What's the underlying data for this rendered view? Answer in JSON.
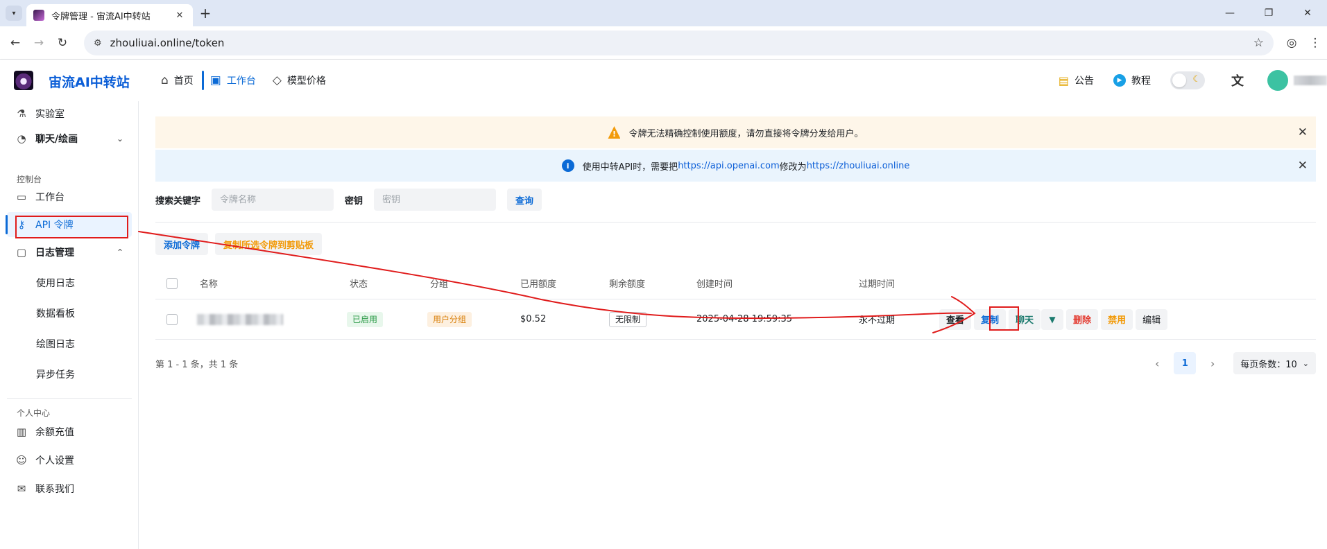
{
  "browser": {
    "tab_title": "令牌管理 - 宙流AI中转站",
    "url": "zhouliuai.online/token",
    "new_tab": "+",
    "min": "—",
    "restore": "❐",
    "close": "✕"
  },
  "header": {
    "brand": "宙流AI中转站",
    "nav": [
      {
        "label": "首页",
        "icon": "home-icon"
      },
      {
        "label": "工作台",
        "icon": "dashboard-icon"
      },
      {
        "label": "模型价格",
        "icon": "price-tag-icon"
      }
    ],
    "notice": "公告",
    "tutorial": "教程"
  },
  "sidebar": {
    "lab": "实验室",
    "chat": "聊天/绘画",
    "group_console": "控制台",
    "workbench": "工作台",
    "api_tokens": "API 令牌",
    "log_mgmt": "日志管理",
    "usage_log": "使用日志",
    "data_board": "数据看板",
    "draw_log": "绘图日志",
    "async_task": "异步任务",
    "group_personal": "个人中心",
    "topup": "余额充值",
    "settings": "个人设置",
    "contact": "联系我们"
  },
  "banners": {
    "warning": "令牌无法精确控制使用额度，请勿直接将令牌分发给用户。",
    "info_prefix": "使用中转API时，需要把",
    "info_link1": "https://api.openai.com",
    "info_mid": "修改为",
    "info_link2": "https://zhouliuai.online"
  },
  "search": {
    "keyword_label": "搜索关键字",
    "keyword_placeholder": "令牌名称",
    "key_label": "密钥",
    "key_placeholder": "密钥",
    "query": "查询"
  },
  "actions": {
    "add_token": "添加令牌",
    "copy_selected": "复制所选令牌到剪贴板"
  },
  "table": {
    "headers": [
      "名称",
      "状态",
      "分组",
      "已用额度",
      "剩余额度",
      "创建时间",
      "过期时间"
    ],
    "rows": [
      {
        "status": "已启用",
        "group": "用户分组",
        "used": "$0.52",
        "remaining": "无限制",
        "created": "2025-04-28 19:59:35",
        "expires": "永不过期",
        "ops": {
          "view": "查看",
          "copy": "复制",
          "chat": "聊天",
          "delete": "删除",
          "disable": "禁用",
          "edit": "编辑"
        }
      }
    ]
  },
  "pagination": {
    "summary": "第 1 - 1 条，共 1 条",
    "current": "1",
    "page_size": "每页条数：10"
  },
  "colors": {
    "accent": "#0b6ad6",
    "warning_bg": "#fef6e9",
    "info_bg": "#eaf4fd",
    "annotation": "#e01b1b"
  }
}
